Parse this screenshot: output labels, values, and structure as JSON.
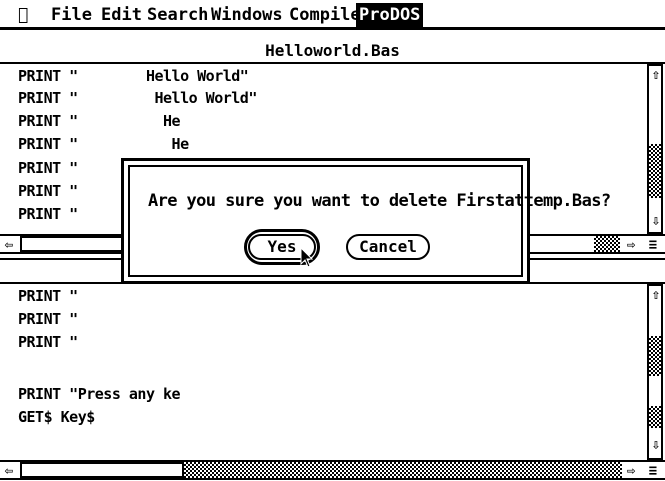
{
  "menubar": {
    "apple_icon": "apple-icon",
    "items": [
      {
        "label": "File"
      },
      {
        "label": "Edit"
      },
      {
        "label": "Search"
      },
      {
        "label": "Windows"
      },
      {
        "label": "Compile"
      },
      {
        "label": "ProDOS"
      }
    ],
    "selected": "ProDOS"
  },
  "window": {
    "title": "Helloworld.Bas"
  },
  "top_pane": {
    "lines": [
      "PRINT \"        Hello World\"",
      "PRINT \"         Hello World\"",
      "PRINT \"          He",
      "PRINT \"           He",
      "PRINT \"",
      "PRINT \"",
      "PRINT \""
    ]
  },
  "bottom_pane": {
    "lines": [
      "PRINT \"",
      "PRINT \"",
      "PRINT \"",
      "",
      "PRINT \"Press any ke",
      "GET$ Key$"
    ]
  },
  "dialog": {
    "message": "Are you sure you want to delete Firstattemp.Bas?",
    "yes_label": "Yes",
    "cancel_label": "Cancel"
  },
  "icons": {
    "up": "up-arrow-icon",
    "down": "down-arrow-icon",
    "left": "left-arrow-icon",
    "right": "right-arrow-icon",
    "split": "split-window-icon",
    "cursor": "mouse-pointer-icon"
  },
  "colors": {
    "foreground": "#000000",
    "background": "#ffffff"
  }
}
